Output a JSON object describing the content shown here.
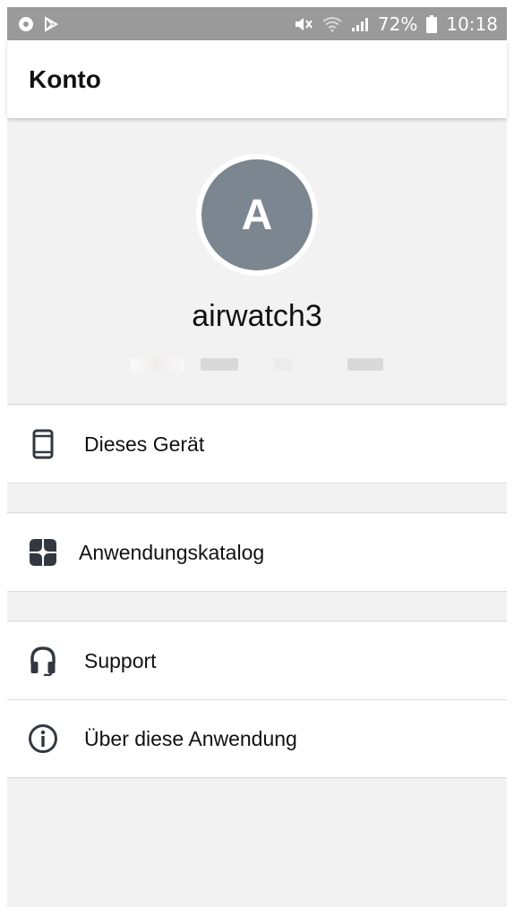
{
  "status_bar": {
    "battery": "72%",
    "time": "10:18",
    "left_icons": [
      "app-notification-icon",
      "play-store-icon"
    ],
    "right_icons": [
      "mute-icon",
      "wifi-icon",
      "signal-icon",
      "battery-icon"
    ]
  },
  "header": {
    "title": "Konto"
  },
  "profile": {
    "avatar_letter": "A",
    "username": "airwatch3",
    "avatar_color": "#7b8690"
  },
  "menu": {
    "items": [
      {
        "label": "Dieses Gerät",
        "icon": "phone-icon"
      },
      {
        "label": "Anwendungskatalog",
        "icon": "catalog-grid-icon"
      },
      {
        "label": "Support",
        "icon": "headset-icon"
      },
      {
        "label": "Über diese Anwendung",
        "icon": "info-icon"
      }
    ]
  },
  "colors": {
    "status_bar": "#9a9a9a",
    "background": "#f2f2f2",
    "icon": "#333840"
  }
}
